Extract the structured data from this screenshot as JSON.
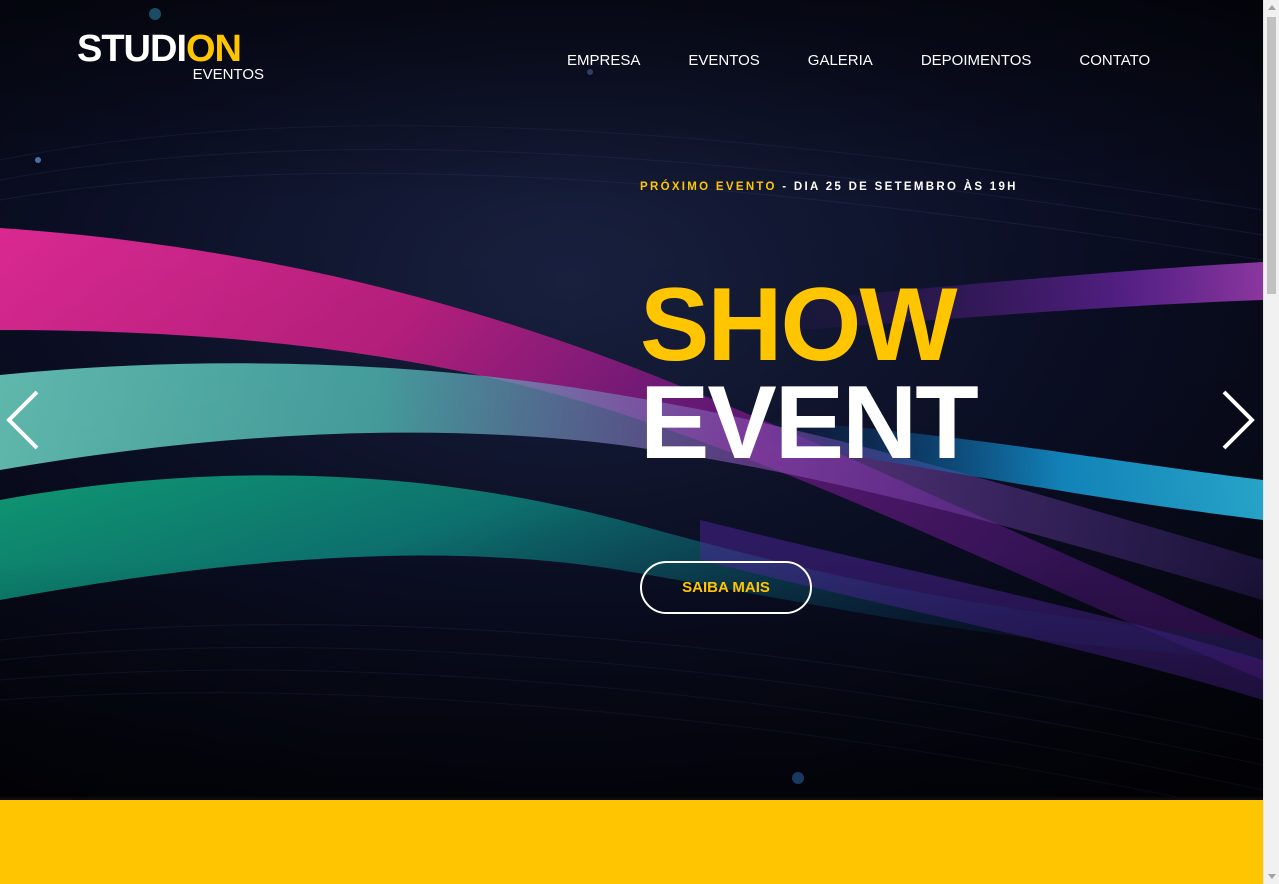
{
  "header": {
    "logo": {
      "main_prefix": "STUDI",
      "main_accent": "ON",
      "sub": "EVENTOS"
    },
    "nav": [
      {
        "label": "EMPRESA"
      },
      {
        "label": "EVENTOS"
      },
      {
        "label": "GALERIA"
      },
      {
        "label": "DEPOIMENTOS"
      },
      {
        "label": "CONTATO"
      }
    ]
  },
  "hero": {
    "kicker_accent": "PRÓXIMO EVENTO",
    "kicker_rest": " - DIA 25 DE SETEMBRO ÀS 19H",
    "headline_line1": "SHOW",
    "headline_line2": "EVENT",
    "cta_label": "SAIBA MAIS",
    "prev_icon": "chevron-left-icon",
    "next_icon": "chevron-right-icon"
  },
  "colors": {
    "accent": "#ffc600",
    "background": "#05060f",
    "text": "#ffffff"
  }
}
